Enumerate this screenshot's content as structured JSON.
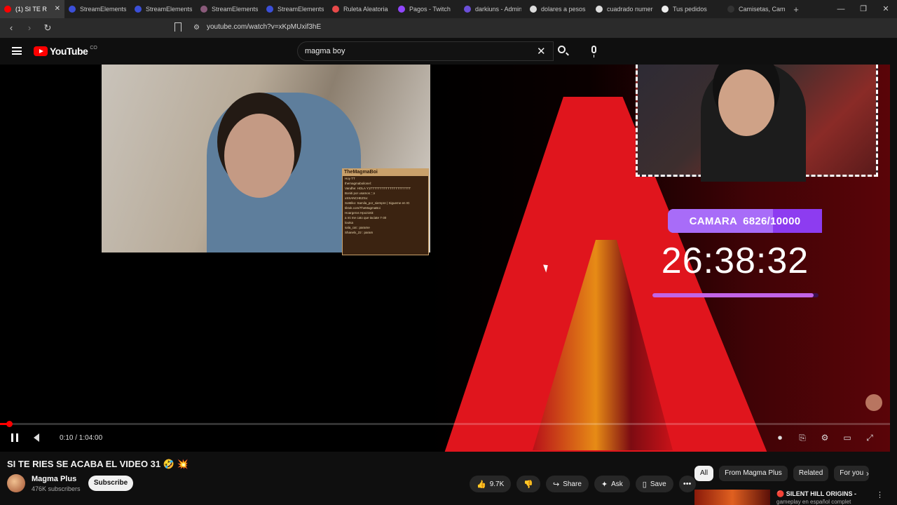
{
  "browser": {
    "tabs": [
      {
        "label": "(1) SI TE R",
        "color": "#ff0000",
        "active": true
      },
      {
        "label": "StreamElements",
        "color": "#3b4fd8"
      },
      {
        "label": "StreamElements",
        "color": "#3b4fd8"
      },
      {
        "label": "StreamElements",
        "color": "#8a5a7a"
      },
      {
        "label": "StreamElements",
        "color": "#3b4fd8"
      },
      {
        "label": "Ruleta Aleatoria",
        "color": "#e84a4a"
      },
      {
        "label": "Pagos - Twitch",
        "color": "#9146ff"
      },
      {
        "label": "darkiuns - Admin",
        "color": "#6b4fd8"
      },
      {
        "label": "dolares a pesos c",
        "color": "#dddddd"
      },
      {
        "label": "cuadrado numero",
        "color": "#dddddd"
      },
      {
        "label": "Tus pedidos",
        "color": "#eeeeee"
      },
      {
        "label": "Camisetas, Cami",
        "color": "#333333"
      }
    ],
    "url": "youtube.com/watch?v=xKpMUxif3hE"
  },
  "youtube": {
    "logo_text": "YouTube",
    "country_code": "CO",
    "search_value": "magma boy"
  },
  "overlay": {
    "chat_title": "TheMagmaBoi",
    "chat_lines": [
      "Hoy TT",
      "themagmaboilonel: ",
      "Vandhe: HOLA Y1TTTTTTTTTTTTTTTTTTTTT",
      "Boniti por usamos ;',n",
      "xSSANCHEZSx: ",
      "SoMiko: Samila_por_siempre | Sigueme en IG",
      "tiktok.com/TheMagmaBoi",
      "Hoargerxs Hpo2183: ",
      "a mi me cato que taciate 7-30",
      "loutsa",
      "sala_cat : parame",
      "Shanelx_22 : param"
    ],
    "goal_label": "CAMARA",
    "goal_value": "6826/10000",
    "goal_progress": 0.6826,
    "timer": "26:38:32",
    "timer_progress": 0.97
  },
  "player": {
    "time_display": "0:10 / 1:04:00",
    "progress": 0.003
  },
  "video": {
    "title": "SI TE RIES SE ACABA EL VIDEO 31 🤣 💥",
    "channel": "Magma Plus",
    "subscribers": "476K subscribers",
    "subscribe_label": "Subscribe",
    "likes": "9.7K",
    "share_label": "Share",
    "ask_label": "Ask",
    "save_label": "Save"
  },
  "chips": [
    "All",
    "From Magma Plus",
    "Related",
    "For you"
  ],
  "recommendation": {
    "title": "SILENT HILL ORIGINS -",
    "subtitle": "gameplay en español complet"
  },
  "colors": {
    "accent": "#ff0000",
    "goal": "#8d3cf0",
    "timer_bar": "#c264e6"
  }
}
